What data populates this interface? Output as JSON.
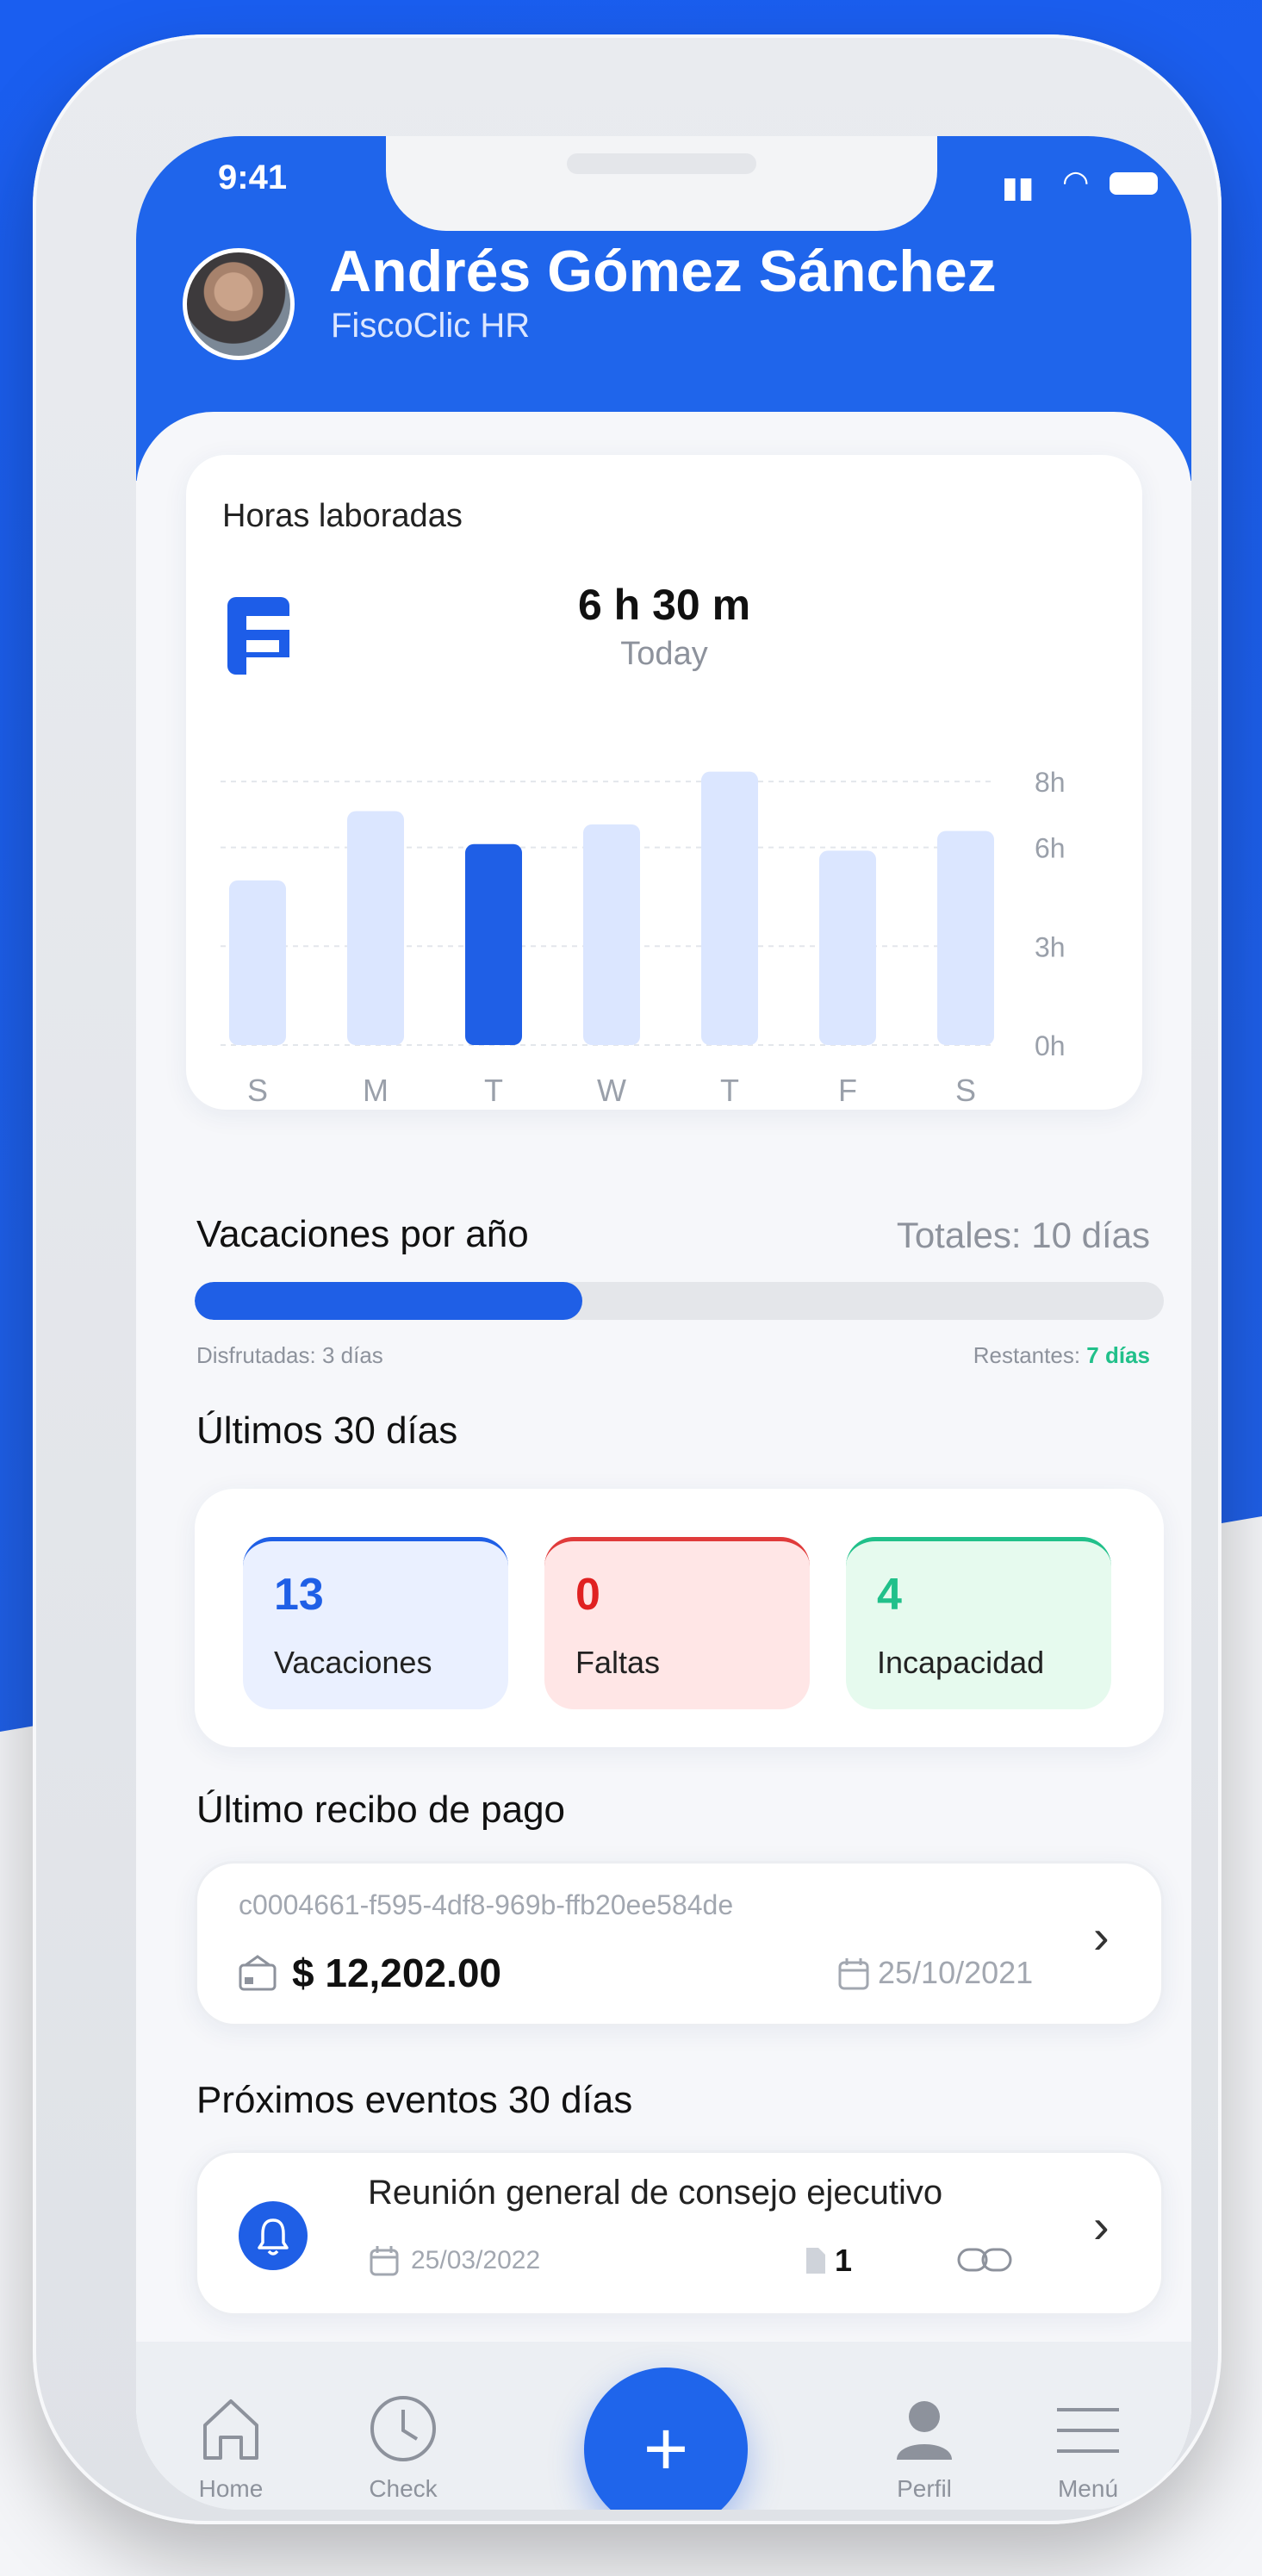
{
  "status": {
    "time": "9:41"
  },
  "user": {
    "name": "Andrés Gómez Sánchez",
    "company": "FiscoClic HR"
  },
  "hours_card": {
    "title": "Horas laboradas",
    "total": "6 h 30 m",
    "period": "Today"
  },
  "chart_data": {
    "type": "bar",
    "categories": [
      "S",
      "M",
      "T",
      "W",
      "T",
      "F",
      "S"
    ],
    "values": [
      5.0,
      7.1,
      6.1,
      6.7,
      8.3,
      5.9,
      6.5
    ],
    "highlight_index": 2,
    "y_ticks": [
      "8h",
      "6h",
      "3h",
      "0h"
    ],
    "colors": {
      "bar": "#dbe6ff",
      "highlight": "#1f5fe6"
    }
  },
  "vacations": {
    "title": "Vacaciones por año",
    "total": "Totales: 10 días",
    "used_label": "Disfrutadas: 3 días",
    "remaining_prefix": "Restantes: ",
    "remaining_value": "7 días",
    "progress": 0.4
  },
  "last30": {
    "title": "Últimos 30 días",
    "stats": [
      {
        "value": "13",
        "label": "Vacaciones"
      },
      {
        "value": "0",
        "label": "Faltas"
      },
      {
        "value": "4",
        "label": "Incapacidad"
      }
    ]
  },
  "receipt": {
    "title": "Último recibo de pago",
    "id": "c0004661-f595-4df8-969b-ffb20ee584de",
    "amount": "$ 12,202.00",
    "date": "25/10/2021"
  },
  "events": {
    "title": "Próximos eventos 30 días",
    "item": {
      "title": "Reunión general de consejo ejecutivo",
      "date": "25/03/2022",
      "count": "1"
    }
  },
  "tabs": [
    {
      "label": "Home",
      "icon": "home-icon"
    },
    {
      "label": "Check",
      "icon": "clock-icon"
    },
    {
      "label": "Perfil",
      "icon": "person-icon"
    },
    {
      "label": "Menú",
      "icon": "menu-icon"
    }
  ],
  "fab": {
    "symbol": "+"
  }
}
